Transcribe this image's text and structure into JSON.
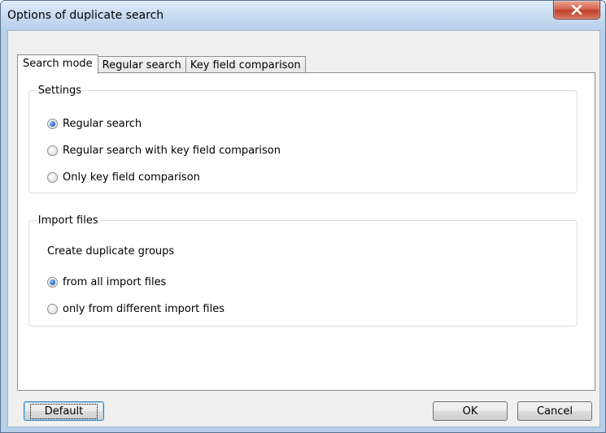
{
  "window": {
    "title": "Options of duplicate search",
    "close_icon": "close-icon"
  },
  "tabs": [
    {
      "label": "Search mode",
      "active": true
    },
    {
      "label": "Regular search",
      "active": false
    },
    {
      "label": "Key field comparison",
      "active": false
    }
  ],
  "settings": {
    "legend": "Settings",
    "options": [
      {
        "label": "Regular search",
        "checked": true
      },
      {
        "label": "Regular search with key field comparison",
        "checked": false
      },
      {
        "label": "Only key field comparison",
        "checked": false
      }
    ]
  },
  "import_files": {
    "legend": "Import files",
    "caption": "Create duplicate groups",
    "options": [
      {
        "label": "from all import files",
        "checked": true
      },
      {
        "label": "only from different import files",
        "checked": false
      }
    ]
  },
  "buttons": {
    "default_label": "Default",
    "ok_label": "OK",
    "cancel_label": "Cancel"
  },
  "colors": {
    "accent": "#2a6ec8",
    "close_button": "#c1412a",
    "frame": "#b7cfe9"
  }
}
